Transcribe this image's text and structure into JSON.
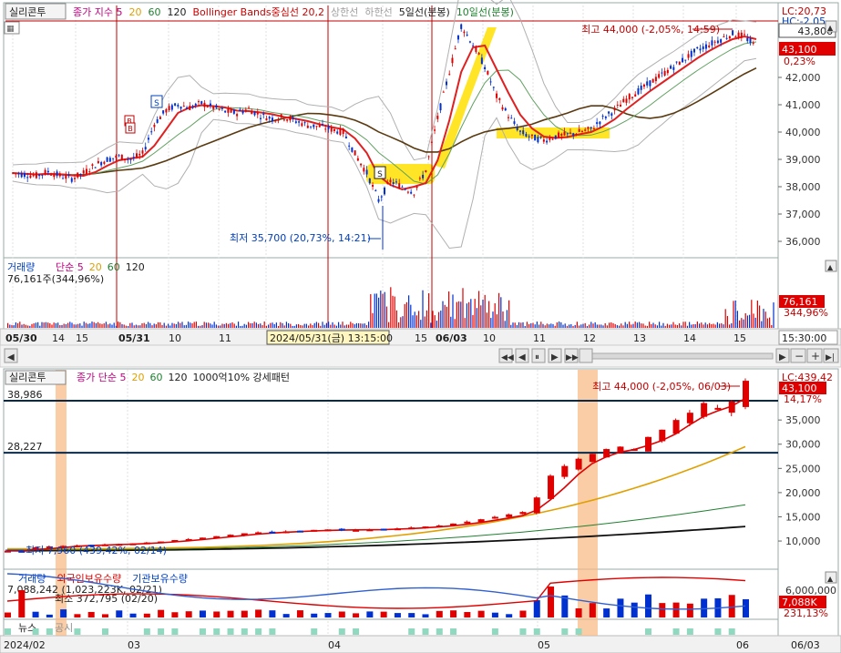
{
  "top": {
    "tab": "실리콘투",
    "legend": [
      {
        "text": "종가 지수 5",
        "color": "#c00080"
      },
      {
        "text": "20",
        "color": "#e0a000"
      },
      {
        "text": "60",
        "color": "#208030"
      },
      {
        "text": "120",
        "color": "#202020"
      },
      {
        "text": "Bollinger Bands중심선 20,2",
        "color": "#d00000"
      },
      {
        "text": "상한선",
        "color": "#a0a0a0"
      },
      {
        "text": "하한선",
        "color": "#a0a0a0"
      },
      {
        "text": "5일선(분봉)",
        "color": "#202020"
      },
      {
        "text": "10일선(분봉)",
        "color": "#208030"
      }
    ],
    "lc": "LC:20,73",
    "hc": "HC:-2,05",
    "high_note": "최고 44,000 (-2,05%, 14:59)",
    "low_note": "최저 35,700 (20,73%, 14:21)",
    "price_badge_blue": "43,806",
    "price_badge_red": "43,100",
    "pct_badge": "0,23%",
    "y_ticks": [
      "42,000",
      "41,000",
      "40,000",
      "39,000",
      "38,000",
      "37,000",
      "36,000"
    ],
    "volume_legend": [
      {
        "text": "거래량",
        "color": "#0040c0"
      },
      {
        "text": "단순 5",
        "color": "#c00080"
      },
      {
        "text": "20",
        "color": "#e0a000"
      },
      {
        "text": "60",
        "color": "#208030"
      },
      {
        "text": "120",
        "color": "#202020"
      }
    ],
    "volume_note": "76,161주(344,96%)",
    "vol_badge": "76,161",
    "vol_pct": "344,96%",
    "x_labels": [
      "05/30",
      "14",
      "15",
      "05/31",
      "10",
      "11",
      "15",
      "06/03",
      "10",
      "11",
      "12",
      "13",
      "14",
      "15"
    ],
    "crosshair_time": "2024/05/31(금) 13:15:00",
    "time_box": "15:30:00",
    "marker_s": "S",
    "marker_b": "B"
  },
  "bottom": {
    "tab": "실리콘투",
    "legend": [
      {
        "text": "종가 단순 5",
        "color": "#c00080"
      },
      {
        "text": "20",
        "color": "#e0a000"
      },
      {
        "text": "60",
        "color": "#208030"
      },
      {
        "text": "120",
        "color": "#202020"
      },
      {
        "text": "1000억10% 강세패턴",
        "color": "#202020"
      }
    ],
    "lc": "LC:439,42",
    "high_note": "최고 44,000 (-2,05%, 06/03)",
    "low_note": "최저 7,960 (439,42%, 02/14)",
    "hline_labels": [
      "38,986",
      "28,227"
    ],
    "price_badge": "43,100",
    "pct_badge": "14,17%",
    "y_ticks": [
      "35,000",
      "30,000",
      "25,000",
      "20,000",
      "15,000",
      "10,000"
    ],
    "volume_legend": [
      {
        "text": "거래량",
        "color": "#0040c0"
      },
      {
        "text": "외국인보유수량",
        "color": "#d00000"
      },
      {
        "text": "기관보유수량",
        "color": "#0040c0"
      }
    ],
    "vol_note1": "7,088,242 (1,023,223K, 02/21)",
    "vol_note2": "최소 372,795 (02/20)",
    "vol_badge": "7,088K",
    "vol_pct": "231,13%",
    "vol_tick": "6,000,000",
    "news_label": "뉴스",
    "news_label2": "공시",
    "x_labels": [
      "2024/02",
      "03",
      "04",
      "05",
      "06",
      "06/03"
    ]
  },
  "chart_data": [
    {
      "type": "candlestick",
      "title": "실리콘투",
      "timeframe": "minute",
      "ylim": [
        35500,
        44500
      ],
      "x_labels": [
        "05/30",
        "14",
        "15",
        "05/31",
        "10",
        "11",
        "15",
        "06/03",
        "10",
        "11",
        "12",
        "13",
        "14",
        "15"
      ],
      "y_ticks": [
        42000,
        41000,
        40000,
        39000,
        38000,
        37000,
        36000
      ],
      "series_close": [
        38500,
        38450,
        38400,
        38550,
        38400,
        38300,
        38500,
        38800,
        39000,
        39100,
        39000,
        39200,
        40300,
        40800,
        41000,
        40900,
        41050,
        40900,
        40750,
        40700,
        40850,
        40600,
        40500,
        40550,
        40400,
        40250,
        40200,
        40100,
        40000,
        39200,
        38500,
        37500,
        38200,
        38000,
        37800,
        38600,
        40500,
        42200,
        43900,
        43200,
        42400,
        41300,
        40600,
        40000,
        39800,
        39700,
        39850,
        39900,
        40000,
        40100,
        40500,
        40800,
        41200,
        41500,
        41800,
        42100,
        42400,
        42700,
        43000,
        43200,
        43400,
        43600,
        43500,
        43100
      ],
      "high": 44000,
      "low": 35700,
      "last": 43100,
      "annotations": [
        "최고 44,000 (-2,05%, 14:59)",
        "최저 35,700 (20,73%, 14:21)"
      ]
    },
    {
      "type": "candlestick",
      "title": "실리콘투",
      "timeframe": "daily",
      "ylim": [
        7000,
        45000
      ],
      "x_labels": [
        "2024/02",
        "03",
        "04",
        "05",
        "06"
      ],
      "y_ticks": [
        35000,
        30000,
        25000,
        20000,
        15000,
        10000
      ],
      "hlines": [
        38986,
        28227
      ],
      "series_close": [
        8000,
        7960,
        8700,
        8900,
        9000,
        9100,
        9200,
        9300,
        9400,
        9500,
        9700,
        9900,
        10200,
        10400,
        10700,
        11000,
        11300,
        11600,
        11800,
        11900,
        12000,
        12100,
        12300,
        12400,
        12200,
        12300,
        12400,
        12500,
        12600,
        12800,
        13000,
        13200,
        13600,
        14000,
        14500,
        15000,
        15500,
        16000,
        19000,
        23500,
        25500,
        27000,
        28000,
        29000,
        29500,
        29000,
        31500,
        33000,
        35000,
        36500,
        38500,
        37500,
        38800,
        43100
      ],
      "ma5_end": 38500,
      "ma20_end": 29500,
      "ma60_end": 17500,
      "ma120_end": 13000,
      "high": 44000,
      "low": 7960,
      "last": 43100,
      "annotations": [
        "최고 44,000 (-2,05%, 06/03)",
        "최저 7,960 (439,42%, 02/14)"
      ]
    }
  ]
}
